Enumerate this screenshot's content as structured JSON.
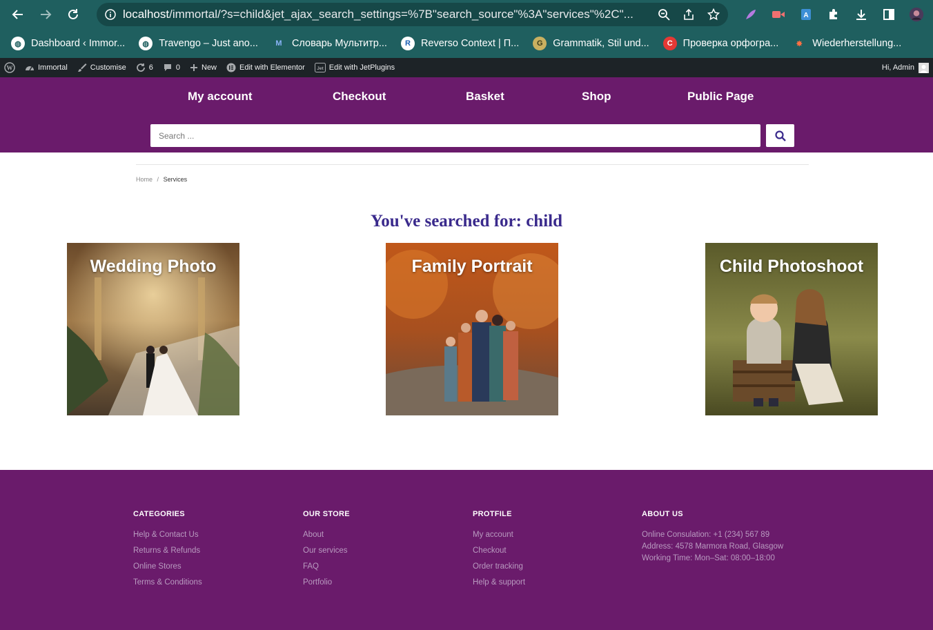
{
  "browser": {
    "url_host": "localhost",
    "url_rest": "/immortal/?s=child&jet_ajax_search_settings=%7B\"search_source\"%3A\"services\"%2C\"...",
    "bookmarks": [
      {
        "label": "Dashboard ‹ Immor...",
        "icon": "globe-icon"
      },
      {
        "label": "Travengo – Just ano...",
        "icon": "globe-icon"
      },
      {
        "label": "Словарь Мультитр...",
        "icon": "multitran-icon"
      },
      {
        "label": "Reverso Context | П...",
        "icon": "reverso-icon"
      },
      {
        "label": "Grammatik, Stil und...",
        "icon": "grammatik-icon"
      },
      {
        "label": "Проверка орфогра...",
        "icon": "spellcheck-icon"
      },
      {
        "label": "Wiederherstellung...",
        "icon": "maple-leaf-icon"
      }
    ]
  },
  "adminbar": {
    "site": "Immortal",
    "customise": "Customise",
    "updates": "6",
    "comments": "0",
    "new": "New",
    "elementor": "Edit with Elementor",
    "jetplugins": "Edit with JetPlugins",
    "greeting": "Hi, Admin"
  },
  "nav": {
    "items": [
      "My account",
      "Checkout",
      "Basket",
      "Shop",
      "Public Page"
    ]
  },
  "search": {
    "placeholder": "Search ..."
  },
  "breadcrumb": {
    "home": "Home",
    "separator": "/",
    "current": "Services"
  },
  "results": {
    "title": "You've searched for: child",
    "cards": [
      "Wedding Photo",
      "Family Portrait",
      "Child Photoshoot"
    ]
  },
  "footer": {
    "categories": {
      "heading": "CATEGORIES",
      "links": [
        "Help & Contact Us",
        "Returns & Refunds",
        "Online Stores",
        "Terms & Conditions"
      ]
    },
    "store": {
      "heading": "OUR STORE",
      "links": [
        "About",
        "Our services",
        "FAQ",
        "Portfolio"
      ]
    },
    "profile": {
      "heading": "PROTFILE",
      "links": [
        "My account",
        "Checkout",
        "Order tracking",
        "Help & support"
      ]
    },
    "about": {
      "heading": "ABOUT US",
      "lines": [
        "Online Consulation: +1 (234) 567 89",
        "Address: 4578 Marmora Road, Glasgow",
        "Working Time: Mon–Sat: 08:00–18:00"
      ]
    }
  },
  "colors": {
    "chrome": "#1f5f5f",
    "brand_purple": "#6a1b6b",
    "title_blue": "#3a2a8c"
  }
}
